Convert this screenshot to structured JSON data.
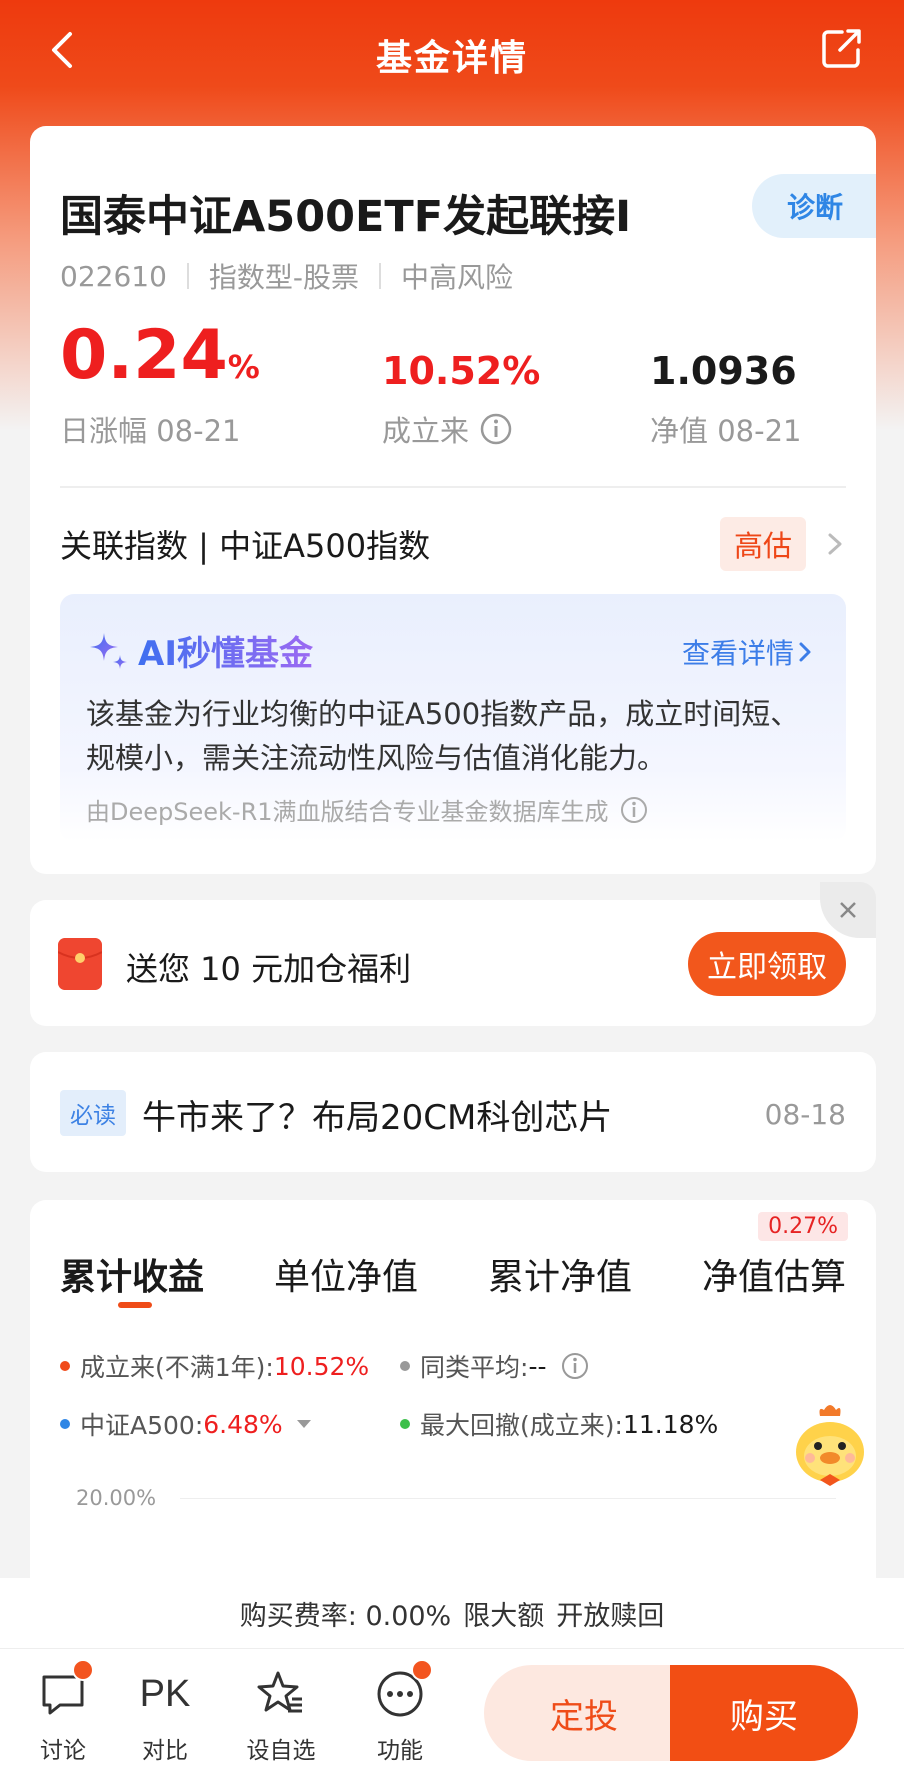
{
  "header": {
    "title": "基金详情"
  },
  "fund": {
    "name": "国泰中证A500ETF发起联接I",
    "diagnose_label": "诊断",
    "code": "022610",
    "type": "指数型-股票",
    "risk": "中高风险"
  },
  "stats": {
    "daily_change": "0.24",
    "daily_change_unit": "%",
    "daily_change_label": "日涨幅 08-21",
    "since_inception": "10.52%",
    "since_inception_label": "成立来",
    "nav": "1.0936",
    "nav_label": "净值 08-21"
  },
  "index_row": {
    "label": "关联指数 | 中证A500指数",
    "badge": "高估"
  },
  "ai": {
    "title": "AI秒懂基金",
    "more": "查看详情",
    "text": "该基金为行业均衡的中证A500指数产品，成立时间短、规模小，需关注流动性风险与估值消化能力。",
    "footer": "由DeepSeek-R1满血版结合专业基金数据库生成"
  },
  "promo": {
    "text": "送您 10 元加仓福利",
    "button": "立即领取"
  },
  "news": {
    "tag": "必读",
    "title": "牛市来了？布局20CM科创芯片",
    "date": "08-18"
  },
  "chart_tabs": {
    "tabs": [
      "累计收益",
      "单位净值",
      "累计净值",
      "净值估算"
    ],
    "estimate_badge": "0.27%"
  },
  "legend": [
    {
      "label": "成立来(不满1年): ",
      "value": "10.52%",
      "color": "#f04a1a"
    },
    {
      "label": "同类平均: ",
      "value": "--",
      "color": "#999999"
    },
    {
      "label": "中证A500: ",
      "value": "6.48%",
      "color": "#2f86e5"
    },
    {
      "label": "最大回撤(成立来): ",
      "value": "11.18%",
      "color": "#3cbf4a"
    }
  ],
  "chart_grid_label": "20.00%",
  "fee": {
    "rate": "购买费率: 0.00%",
    "limit": "限大额",
    "redeem": "开放赎回"
  },
  "bottom_nav": {
    "items": [
      "讨论",
      "对比",
      "设自选",
      "功能"
    ],
    "pk_text": "PK",
    "dingtou": "定投",
    "buy": "购买"
  }
}
